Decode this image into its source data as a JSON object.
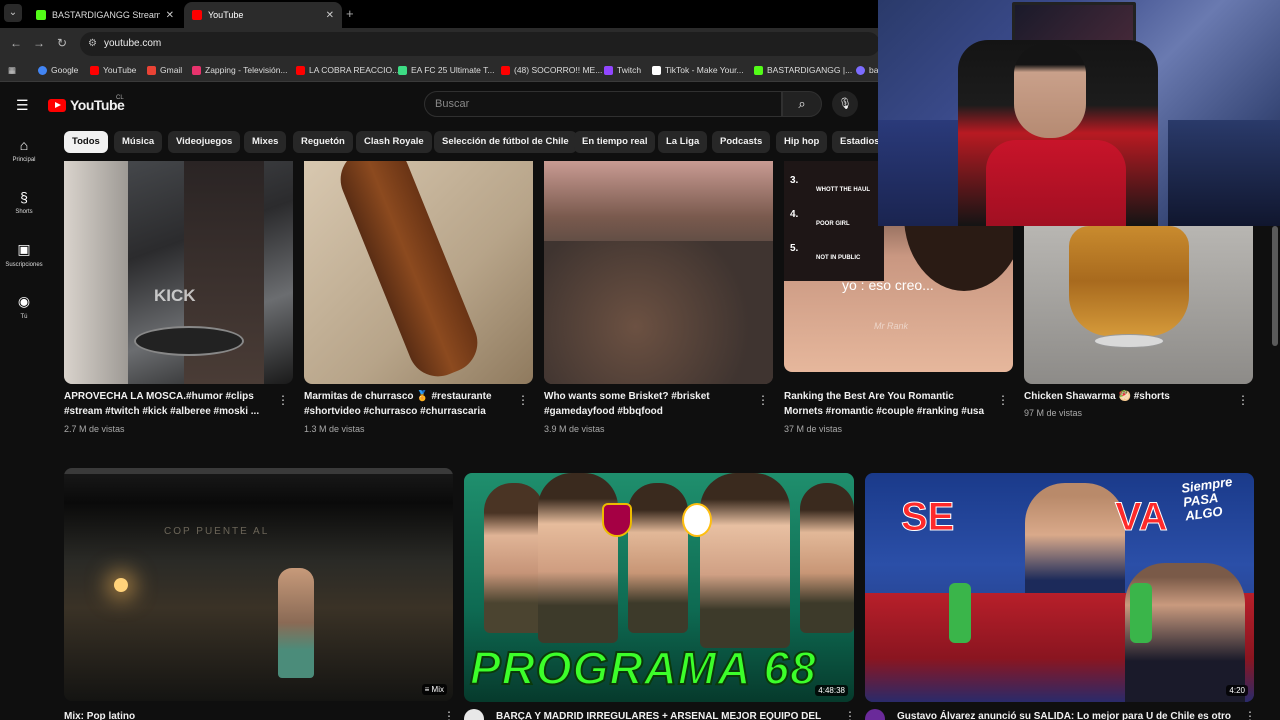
{
  "browser": {
    "tabs": [
      {
        "title": "BASTARDIGANGG Stream - Wa",
        "icon": "kick-icon",
        "color": "#53fc18"
      },
      {
        "title": "YouTube",
        "icon": "youtube-icon",
        "color": "#ff0000"
      }
    ],
    "url": "youtube.com",
    "bookmarks": [
      {
        "label": "Google",
        "color": "#4285f4"
      },
      {
        "label": "YouTube",
        "color": "#ff0000"
      },
      {
        "label": "Gmail",
        "color": "#ea4335"
      },
      {
        "label": "Zapping - Televisión...",
        "color": "#e8336d"
      },
      {
        "label": "LA COBRA REACCIO...",
        "color": "#ff0000"
      },
      {
        "label": "EA FC 25 Ultimate T...",
        "color": "#3ddc84"
      },
      {
        "label": "(48) SOCORRO!! ME...",
        "color": "#ff0000"
      },
      {
        "label": "Twitch",
        "color": "#9146ff"
      },
      {
        "label": "TikTok - Make Your...",
        "color": "#ffffff"
      },
      {
        "label": "BASTARDIGANGG |...",
        "color": "#53fc18"
      },
      {
        "label": "ba",
        "color": "#7c6cff"
      }
    ]
  },
  "youtube": {
    "logo_text": "YouTube",
    "country": "CL",
    "search_placeholder": "Buscar",
    "sidebar": [
      {
        "label": "Principal",
        "icon": "home-icon"
      },
      {
        "label": "Shorts",
        "icon": "shorts-icon"
      },
      {
        "label": "Suscripciones",
        "icon": "subscriptions-icon"
      },
      {
        "label": "Tú",
        "icon": "you-icon"
      }
    ],
    "chips": [
      "Todos",
      "Música",
      "Videojuegos",
      "Mixes",
      "Reguetón",
      "Clash Royale",
      "Selección de fútbol de Chile",
      "En tiempo real",
      "La Liga",
      "Podcasts",
      "Hip hop",
      "Estadios"
    ],
    "shorts": [
      {
        "title": "APROVECHA LA MOSCA.#humor #clips #stream #twitch #kick #alberee #moski ...",
        "views": "2.7 M de vistas",
        "thumb_text": "KICK"
      },
      {
        "title": "Marmitas de churrasco 🏅 #restaurante #shortvideo #churrasco #churrascaria",
        "views": "1.3 M de vistas"
      },
      {
        "title": "Who wants some Brisket? #brisket #gamedayfood #bbqfood",
        "views": "3.9 M de vistas"
      },
      {
        "title": "Ranking the Best Are You Romantic Mornets #romantic #couple #ranking #usa",
        "views": "37 M de vistas",
        "overlay": "yo : eso creo...",
        "list": [
          "3.",
          "WHOTT THE HAUL",
          "4.",
          "POOR GIRL",
          "5.",
          "NOT IN PUBLIC"
        ],
        "watermark": "Mr Rank"
      },
      {
        "title": "Chicken Shawarma 🥙 #shorts",
        "views": "97 M de vistas"
      }
    ],
    "videos": [
      {
        "title": "Mix: Pop latino",
        "badge": "Mix",
        "sign": "COP PUENTE AL"
      },
      {
        "title": "BARÇA Y MADRID IRREGULARES + ARSENAL MEJOR EQUIPO DEL",
        "badge": "4:48:38",
        "thumb_text": "PROGRAMA 68"
      },
      {
        "title": "Gustavo Álvarez anunció su SALIDA: Lo mejor para U de Chile es otro",
        "badge": "4:20",
        "thumb_text_left": "SE",
        "thumb_text_right": "VA",
        "thumb_text_corner": "Siempre PASA ALGO"
      }
    ]
  }
}
